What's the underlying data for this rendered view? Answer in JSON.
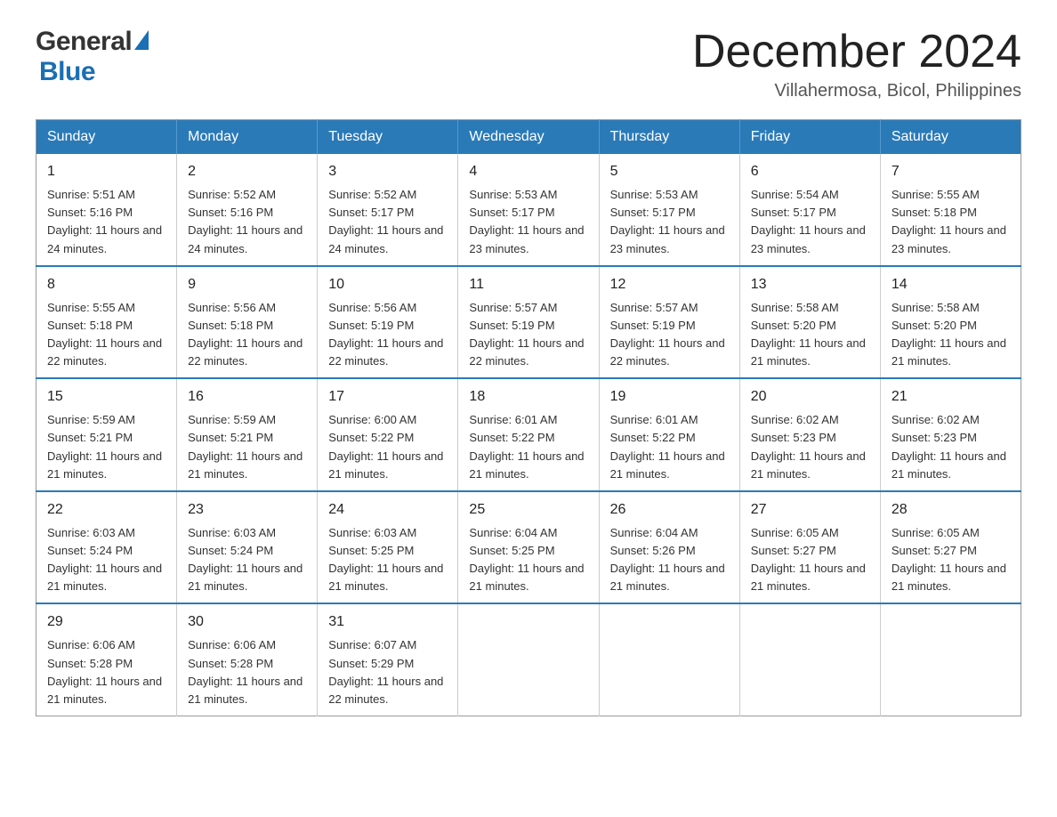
{
  "header": {
    "logo_general": "General",
    "logo_blue": "Blue",
    "month_year": "December 2024",
    "location": "Villahermosa, Bicol, Philippines"
  },
  "days_of_week": [
    "Sunday",
    "Monday",
    "Tuesday",
    "Wednesday",
    "Thursday",
    "Friday",
    "Saturday"
  ],
  "weeks": [
    [
      {
        "day": "1",
        "sunrise": "5:51 AM",
        "sunset": "5:16 PM",
        "daylight": "11 hours and 24 minutes."
      },
      {
        "day": "2",
        "sunrise": "5:52 AM",
        "sunset": "5:16 PM",
        "daylight": "11 hours and 24 minutes."
      },
      {
        "day": "3",
        "sunrise": "5:52 AM",
        "sunset": "5:17 PM",
        "daylight": "11 hours and 24 minutes."
      },
      {
        "day": "4",
        "sunrise": "5:53 AM",
        "sunset": "5:17 PM",
        "daylight": "11 hours and 23 minutes."
      },
      {
        "day": "5",
        "sunrise": "5:53 AM",
        "sunset": "5:17 PM",
        "daylight": "11 hours and 23 minutes."
      },
      {
        "day": "6",
        "sunrise": "5:54 AM",
        "sunset": "5:17 PM",
        "daylight": "11 hours and 23 minutes."
      },
      {
        "day": "7",
        "sunrise": "5:55 AM",
        "sunset": "5:18 PM",
        "daylight": "11 hours and 23 minutes."
      }
    ],
    [
      {
        "day": "8",
        "sunrise": "5:55 AM",
        "sunset": "5:18 PM",
        "daylight": "11 hours and 22 minutes."
      },
      {
        "day": "9",
        "sunrise": "5:56 AM",
        "sunset": "5:18 PM",
        "daylight": "11 hours and 22 minutes."
      },
      {
        "day": "10",
        "sunrise": "5:56 AM",
        "sunset": "5:19 PM",
        "daylight": "11 hours and 22 minutes."
      },
      {
        "day": "11",
        "sunrise": "5:57 AM",
        "sunset": "5:19 PM",
        "daylight": "11 hours and 22 minutes."
      },
      {
        "day": "12",
        "sunrise": "5:57 AM",
        "sunset": "5:19 PM",
        "daylight": "11 hours and 22 minutes."
      },
      {
        "day": "13",
        "sunrise": "5:58 AM",
        "sunset": "5:20 PM",
        "daylight": "11 hours and 21 minutes."
      },
      {
        "day": "14",
        "sunrise": "5:58 AM",
        "sunset": "5:20 PM",
        "daylight": "11 hours and 21 minutes."
      }
    ],
    [
      {
        "day": "15",
        "sunrise": "5:59 AM",
        "sunset": "5:21 PM",
        "daylight": "11 hours and 21 minutes."
      },
      {
        "day": "16",
        "sunrise": "5:59 AM",
        "sunset": "5:21 PM",
        "daylight": "11 hours and 21 minutes."
      },
      {
        "day": "17",
        "sunrise": "6:00 AM",
        "sunset": "5:22 PM",
        "daylight": "11 hours and 21 minutes."
      },
      {
        "day": "18",
        "sunrise": "6:01 AM",
        "sunset": "5:22 PM",
        "daylight": "11 hours and 21 minutes."
      },
      {
        "day": "19",
        "sunrise": "6:01 AM",
        "sunset": "5:22 PM",
        "daylight": "11 hours and 21 minutes."
      },
      {
        "day": "20",
        "sunrise": "6:02 AM",
        "sunset": "5:23 PM",
        "daylight": "11 hours and 21 minutes."
      },
      {
        "day": "21",
        "sunrise": "6:02 AM",
        "sunset": "5:23 PM",
        "daylight": "11 hours and 21 minutes."
      }
    ],
    [
      {
        "day": "22",
        "sunrise": "6:03 AM",
        "sunset": "5:24 PM",
        "daylight": "11 hours and 21 minutes."
      },
      {
        "day": "23",
        "sunrise": "6:03 AM",
        "sunset": "5:24 PM",
        "daylight": "11 hours and 21 minutes."
      },
      {
        "day": "24",
        "sunrise": "6:03 AM",
        "sunset": "5:25 PM",
        "daylight": "11 hours and 21 minutes."
      },
      {
        "day": "25",
        "sunrise": "6:04 AM",
        "sunset": "5:25 PM",
        "daylight": "11 hours and 21 minutes."
      },
      {
        "day": "26",
        "sunrise": "6:04 AM",
        "sunset": "5:26 PM",
        "daylight": "11 hours and 21 minutes."
      },
      {
        "day": "27",
        "sunrise": "6:05 AM",
        "sunset": "5:27 PM",
        "daylight": "11 hours and 21 minutes."
      },
      {
        "day": "28",
        "sunrise": "6:05 AM",
        "sunset": "5:27 PM",
        "daylight": "11 hours and 21 minutes."
      }
    ],
    [
      {
        "day": "29",
        "sunrise": "6:06 AM",
        "sunset": "5:28 PM",
        "daylight": "11 hours and 21 minutes."
      },
      {
        "day": "30",
        "sunrise": "6:06 AM",
        "sunset": "5:28 PM",
        "daylight": "11 hours and 21 minutes."
      },
      {
        "day": "31",
        "sunrise": "6:07 AM",
        "sunset": "5:29 PM",
        "daylight": "11 hours and 22 minutes."
      },
      null,
      null,
      null,
      null
    ]
  ],
  "labels": {
    "sunrise": "Sunrise:",
    "sunset": "Sunset:",
    "daylight": "Daylight:"
  }
}
